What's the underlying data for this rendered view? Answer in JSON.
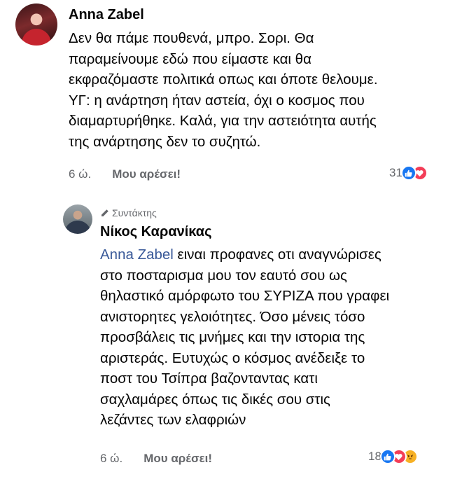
{
  "comments": [
    {
      "author": "Anna Zabel",
      "body_lines": [
        "Δεν θα πάμε πουθενά, μπρο. Σορι. Θα",
        "παραμείνουμε εδώ που είμαστε και θα",
        "εκφραζόμαστε πολιτικά οπως και όποτε θελουμε.",
        "ΥΓ: η ανάρτηση ήταν αστεία, όχι ο κοσμος που",
        "διαμαρτυρήθηκε. Καλά, για την αστειότητα αυτής",
        "της ανάρτησης δεν το συζητώ."
      ],
      "time": "6 ώ.",
      "like_label": "Μου αρέσει!",
      "reaction_count": "31",
      "reactions": [
        "like-icon",
        "love-icon"
      ]
    },
    {
      "badge": "Συντάκτης",
      "author": "Νίκος Καρανίκας",
      "mention": "Anna Zabel",
      "body_first_rest": " ειναι προφανες οτι αναγνώρισες",
      "body_lines": [
        "στο ποσταρισμα μου τον εαυτό σου ως",
        "θηλαστικό αμόρφωτο του ΣΥΡΙΖΑ που γραφει",
        "ανιστορητες γελοιότητες. Όσο μένεις τόσο",
        "προσβάλεις τις μνήμες και την ιστορια της",
        "αριστεράς. Ευτυχώς ο κόσμος ανέδειξε το",
        "ποστ του Τσίπρα βαζονταντας κατι",
        "σαχλαμάρες όπως τις δικές σου στις",
        "λεζάντες των ελαφριών"
      ],
      "time": "6 ώ.",
      "like_label": "Μου αρέσει!",
      "reaction_count": "18",
      "reactions": [
        "like-icon",
        "love-icon",
        "angry-icon"
      ]
    }
  ],
  "colors": {
    "mention": "#385898",
    "like": "#1877f2",
    "love": "#f33e58",
    "angry": "#f7b125",
    "meta": "#65676b"
  }
}
